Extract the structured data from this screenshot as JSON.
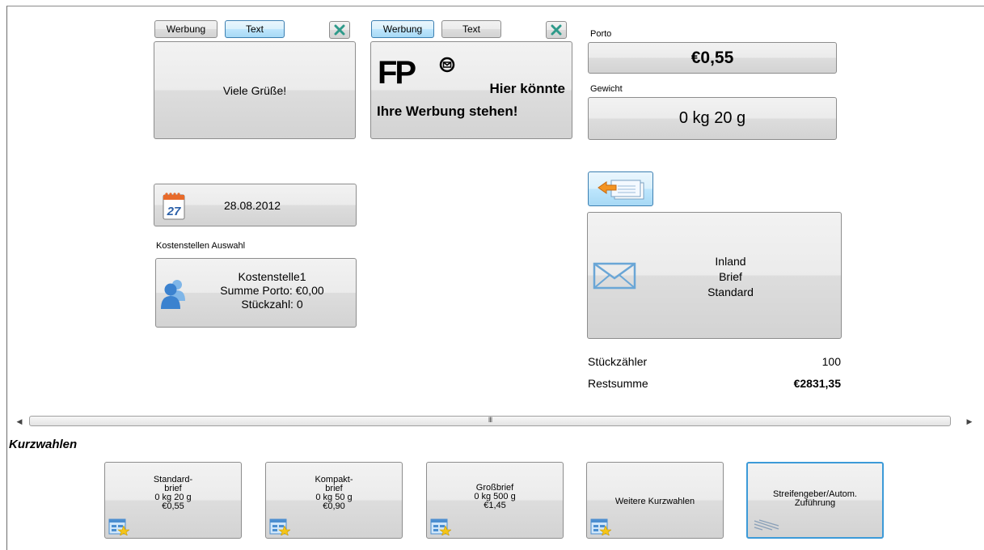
{
  "ad_panel_left": {
    "tab_werbung": "Werbung",
    "tab_text": "Text",
    "content_text": "Viele Grüße!"
  },
  "ad_panel_right": {
    "tab_werbung": "Werbung",
    "tab_text": "Text",
    "logo_text": "FP",
    "ad_line1": "Hier könnte",
    "ad_line2": "Ihre Werbung stehen!"
  },
  "porto": {
    "label": "Porto",
    "value": "€0,55"
  },
  "gewicht": {
    "label": "Gewicht",
    "value": "0 kg 20 g"
  },
  "date": {
    "value": "28.08.2012",
    "calendar_day": "27"
  },
  "cost_center": {
    "label": "Kostenstellen Auswahl",
    "name": "Kostenstelle1",
    "sum": "Summe Porto: €0,00",
    "count": "Stückzahl: 0"
  },
  "product": {
    "line1": "Inland",
    "line2": "Brief",
    "line3": "Standard"
  },
  "counters": {
    "stueck_label": "Stückzähler",
    "stueck_value": "100",
    "rest_label": "Restsumme",
    "rest_value": "€2831,35"
  },
  "scrollbar": {
    "thumb_grip": "III"
  },
  "quick": {
    "title": "Kurzwahlen",
    "items": [
      {
        "lines": [
          "Standard-",
          "brief",
          "0 kg 20 g",
          "€0,55"
        ]
      },
      {
        "lines": [
          "Kompakt-",
          "brief",
          "0 kg 50 g",
          "€0,90"
        ]
      },
      {
        "lines": [
          "Großbrief",
          "0 kg 500 g",
          "€1,45"
        ]
      },
      {
        "lines": [
          "Weitere Kurzwahlen"
        ]
      },
      {
        "lines": [
          "Streifengeber/Autom.",
          "Zuführung"
        ]
      }
    ]
  },
  "colors": {
    "button_blue": "#bee6fd",
    "selected_border": "#3c9ad8",
    "envelope": "#6aa6d6"
  }
}
